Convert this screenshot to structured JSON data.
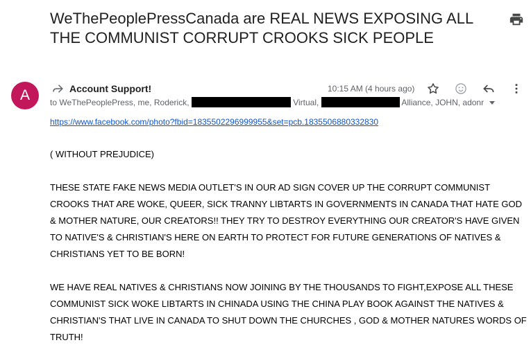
{
  "email": {
    "subject": "WeThePeoplePressCanada are REAL NEWS EXPOSING ALL THE COMMUNIST CORRUPT CROOKS SICK PEOPLE",
    "avatar_letter": "A",
    "avatar_color": "#c2185b",
    "sender_name": "Account Support!",
    "timestamp": "10:15 AM (4 hours ago)",
    "recipients": {
      "part1": "to WeThePeoplePress, me, Roderick,",
      "part2": "Virtual,",
      "part3": "Alliance, JOHN, adonr"
    },
    "link": "https://www.facebook.com/photo?fbid=1835502296999955&set=pcb.1835506880332830",
    "paragraphs": [
      "( WITHOUT PREJUDICE)",
      "THESE STATE FAKE NEWS MEDIA OUTLET'S IN OUR AD SIGN COVER UP THE CORRUPT COMMUNIST CROOKS THAT ARE WOKE, QUEER,  SICK TRANNY LIBTARTS IN GOVERNMENTS IN CANADA THAT HATE GOD & MOTHER NATURE, OUR CREATORS!! THEY TRY TO DESTROY EVERYTHING  OUR CREATOR'S HAVE GIVEN TO NATIVE'S & CHRISTIAN'S HERE ON EARTH  TO PROTECT FOR FUTURE GENERATIONS OF NATIVES & CHRISTIANS YET TO BE BORN!",
      "WE HAVE REAL NATIVES & CHRISTIANS NOW JOINING BY THE THOUSANDS TO FIGHT,EXPOSE ALL THESE COMMUNIST SICK WOKE LIBTARTS IN CHINADA USING THE CHINA PLAY BOOK AGAINST THE NATIVES & CHRISTIAN'S THAT LIVE IN CANADA TO SHUT DOWN THE CHURCHES , GOD & MOTHER NATURES WORDS OF TRUTH!"
    ]
  },
  "icons": {
    "print": "print-icon",
    "forward": "forward-arrow-icon",
    "star": "star-icon",
    "emoji": "emoji-reaction-icon",
    "reply": "reply-icon",
    "more": "more-vert-icon",
    "expand": "chevron-down-icon"
  }
}
